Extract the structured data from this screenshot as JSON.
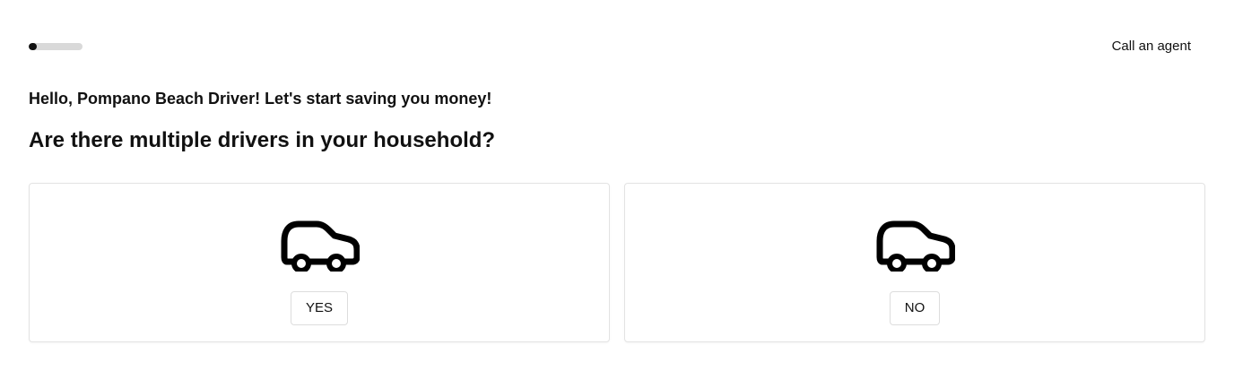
{
  "header": {
    "progress_percent": 15,
    "call_agent_label": "Call an agent"
  },
  "main": {
    "greeting": "Hello, Pompano Beach Driver! Let's start saving you money!",
    "question": "Are there multiple drivers in your household?",
    "options": [
      {
        "label": "YES",
        "icon": "car-icon"
      },
      {
        "label": "NO",
        "icon": "car-icon"
      }
    ]
  },
  "colors": {
    "accent": "#111111",
    "progress_track": "#d9d9d9",
    "card_border": "#e3e3e3"
  }
}
